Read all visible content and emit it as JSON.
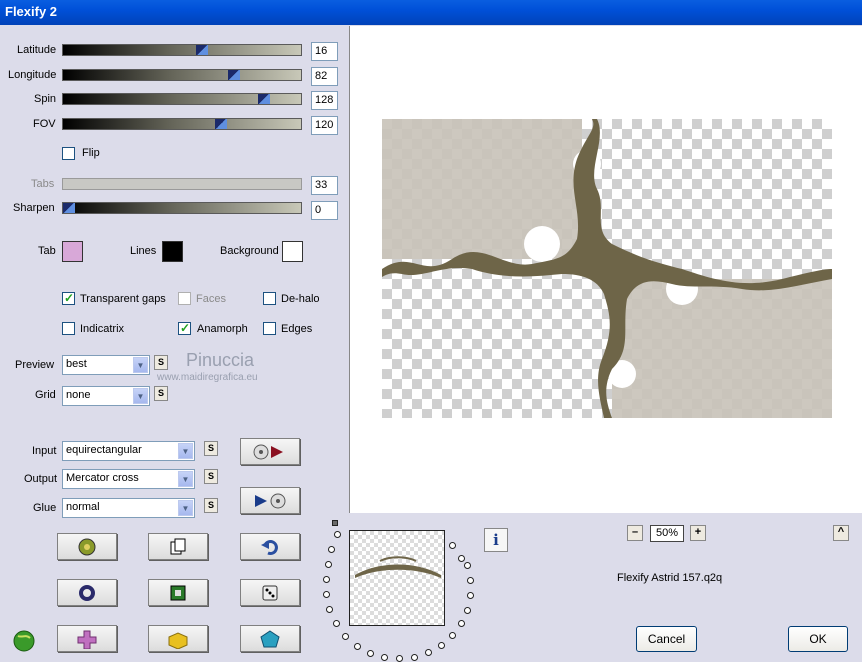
{
  "window": {
    "title": "Flexify 2"
  },
  "sliders": [
    {
      "label": "Latitude",
      "value": "16",
      "level": 0.6,
      "disabled": false
    },
    {
      "label": "Longitude",
      "value": "82",
      "level": 0.73,
      "disabled": false
    },
    {
      "label": "Spin",
      "value": "128",
      "level": 0.85,
      "disabled": false
    },
    {
      "label": "FOV",
      "value": "120",
      "level": 0.67,
      "disabled": false
    },
    {
      "label": "Tabs",
      "value": "33",
      "level": 0,
      "disabled": true
    },
    {
      "label": "Sharpen",
      "value": "0",
      "level": 0,
      "disabled": false
    }
  ],
  "flip": {
    "label": "Flip",
    "checked": false
  },
  "colors": {
    "tab_label": "Tab",
    "tab_color": "#d8a8d8",
    "lines_label": "Lines",
    "lines_color": "#000000",
    "background_label": "Background",
    "background_color": "#ffffff"
  },
  "options": {
    "transparent_gaps": {
      "label": "Transparent gaps",
      "checked": true
    },
    "faces": {
      "label": "Faces",
      "checked": false
    },
    "de_halo": {
      "label": "De-halo",
      "checked": false
    },
    "indicatrix": {
      "label": "Indicatrix",
      "checked": false
    },
    "anamorph": {
      "label": "Anamorph",
      "checked": true
    },
    "edges": {
      "label": "Edges",
      "checked": false
    }
  },
  "preview_select": {
    "label": "Preview",
    "value": "best"
  },
  "grid_select": {
    "label": "Grid",
    "value": "none"
  },
  "input_select": {
    "label": "Input",
    "value": "equirectangular"
  },
  "output_select": {
    "label": "Output",
    "value": "Mercator cross"
  },
  "glue_select": {
    "label": "Glue",
    "value": "normal"
  },
  "small_button_glyph": "S",
  "watermark": {
    "name": "Pinuccia",
    "url": "www.maidiregrafica.eu"
  },
  "zoom": {
    "minus": "–",
    "value": "50%",
    "plus": "+",
    "collapse": "^"
  },
  "filename": "Flexify Astrid 157.q2q",
  "buttons": {
    "cancel": "Cancel",
    "ok": "OK"
  },
  "colors_ui": {
    "shape": "#6e6548",
    "accent": "#0054e3"
  }
}
